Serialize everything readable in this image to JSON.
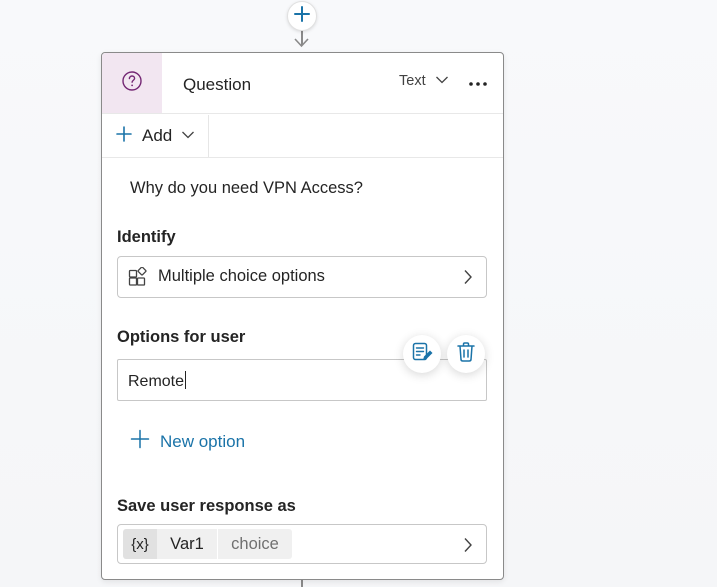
{
  "card": {
    "title": "Question",
    "response_type": "Text",
    "add_label": "Add",
    "message": "Why do you need VPN Access?",
    "identify": {
      "label": "Identify",
      "value": "Multiple choice options"
    },
    "options": {
      "label": "Options for user",
      "items": [
        "Remote"
      ],
      "new_option_label": "New option"
    },
    "save": {
      "label": "Save user response as",
      "var_icon": "{x}",
      "var_name": "Var1",
      "var_type": "choice"
    }
  },
  "icons": {
    "add_node": "plus-icon",
    "question": "question-circle-icon",
    "type_chevron": "chevron-down-icon",
    "more": "more-horizontal-icon",
    "identify": "grid-shapes-icon",
    "edit_option": "edit-note-icon",
    "delete_option": "trash-icon"
  },
  "colors": {
    "accent": "#1a73a8",
    "question_tile": "#f2e6f1",
    "border": "#8a8a8a"
  }
}
